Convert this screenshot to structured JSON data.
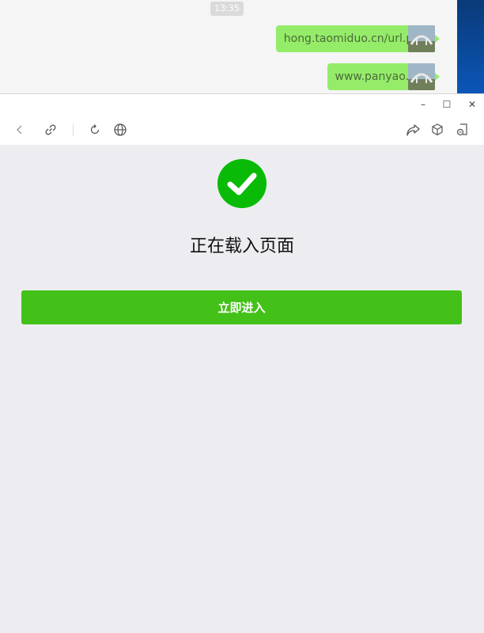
{
  "chat": {
    "timestamp": "13:35",
    "messages": [
      {
        "text": "hong.taomiduo.cn/url.php"
      },
      {
        "text": "www.panyao.net"
      }
    ]
  },
  "window": {
    "controls": {
      "minimize": "–",
      "maximize": "☐",
      "close": "✕"
    }
  },
  "toolbar": {
    "icons": [
      "back-icon",
      "link-icon",
      "refresh-icon",
      "globe-icon",
      "share-icon",
      "cube-icon",
      "minimize-to-chat-icon"
    ]
  },
  "page": {
    "title": "正在载入页面",
    "enter_button": "立即进入",
    "status_color": "#09bb07",
    "button_color": "#44c118"
  }
}
